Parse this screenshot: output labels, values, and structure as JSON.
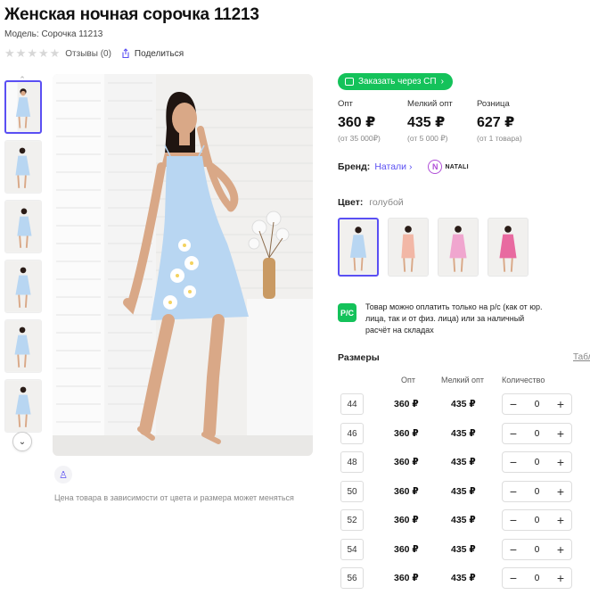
{
  "product": {
    "title": "Женская ночная сорочка 11213",
    "model": "Модель: Сорочка 11213",
    "reviews": "Отзывы (0)",
    "share": "Поделиться",
    "rating_stars": 0
  },
  "gallery": {
    "price_note": "Цена товара в зависимости от цвета и размера может меняться"
  },
  "order_button": "Заказать через СП",
  "prices": [
    {
      "label": "Опт",
      "value": "360 ₽",
      "sub": "(от 35 000₽)"
    },
    {
      "label": "Мелкий опт",
      "value": "435 ₽",
      "sub": "(от 5 000 ₽)"
    },
    {
      "label": "Розница",
      "value": "627 ₽",
      "sub": "(от 1 товара)"
    }
  ],
  "brand": {
    "label": "Бренд:",
    "name": "Натали",
    "logo_text": "NATALI"
  },
  "color": {
    "label": "Цвет:",
    "value": "голубой"
  },
  "payment_text": "Товар можно оплатить только на р/с (как от юр. лица, так и от физ. лица) или за наличный расчёт на складах",
  "payment_icon": "Р/С",
  "sizes": {
    "title": "Размеры",
    "table_link": "Табл",
    "headers": {
      "opt": "Опт",
      "small": "Мелкий опт",
      "qty": "Количество"
    },
    "rows": [
      {
        "size": "44",
        "opt": "360 ₽",
        "small": "435 ₽",
        "qty": "0"
      },
      {
        "size": "46",
        "opt": "360 ₽",
        "small": "435 ₽",
        "qty": "0"
      },
      {
        "size": "48",
        "opt": "360 ₽",
        "small": "435 ₽",
        "qty": "0"
      },
      {
        "size": "50",
        "opt": "360 ₽",
        "small": "435 ₽",
        "qty": "0"
      },
      {
        "size": "52",
        "opt": "360 ₽",
        "small": "435 ₽",
        "qty": "0"
      },
      {
        "size": "54",
        "opt": "360 ₽",
        "small": "435 ₽",
        "qty": "0"
      },
      {
        "size": "56",
        "opt": "360 ₽",
        "small": "435 ₽",
        "qty": "0"
      }
    ]
  },
  "colors": {
    "accent": "#5a4ff3",
    "green": "#14c25a",
    "dress_blue": "#b8d6f2",
    "swatch_colors": [
      "#b8d6f2",
      "#f2b7a6",
      "#f0a6cf",
      "#e86aa0"
    ]
  }
}
